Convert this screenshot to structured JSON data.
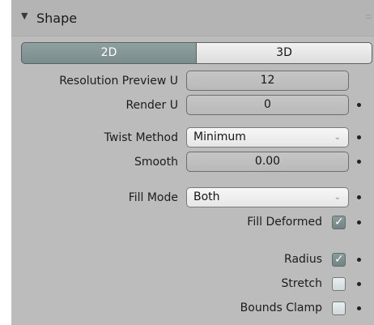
{
  "panel": {
    "title": "Shape",
    "collapse_icon": "triangle-down-icon",
    "grip_icon": "drag-grip-icon",
    "grip_text": ":::"
  },
  "mode_toggle": {
    "options": [
      "2D",
      "3D"
    ],
    "selected": "2D"
  },
  "fields": {
    "resolution_preview_u": {
      "label": "Resolution Preview U",
      "value": "12"
    },
    "render_u": {
      "label": "Render U",
      "value": "0"
    },
    "twist_method": {
      "label": "Twist Method",
      "value": "Minimum"
    },
    "smooth": {
      "label": "Smooth",
      "value": "0.00"
    },
    "fill_mode": {
      "label": "Fill Mode",
      "value": "Both"
    }
  },
  "checkboxes": {
    "fill_deformed": {
      "label": "Fill Deformed",
      "checked": true
    },
    "radius": {
      "label": "Radius",
      "checked": true
    },
    "stretch": {
      "label": "Stretch",
      "checked": false
    },
    "bounds_clamp": {
      "label": "Bounds Clamp",
      "checked": false
    }
  },
  "glyphs": {
    "triangle": "▼",
    "chevron": "⌄",
    "check": "✓"
  },
  "colors": {
    "panel_bg": "#bcbcbc",
    "selected_segment": "#8a9b9b",
    "checked_box": "#7d8f8f"
  }
}
